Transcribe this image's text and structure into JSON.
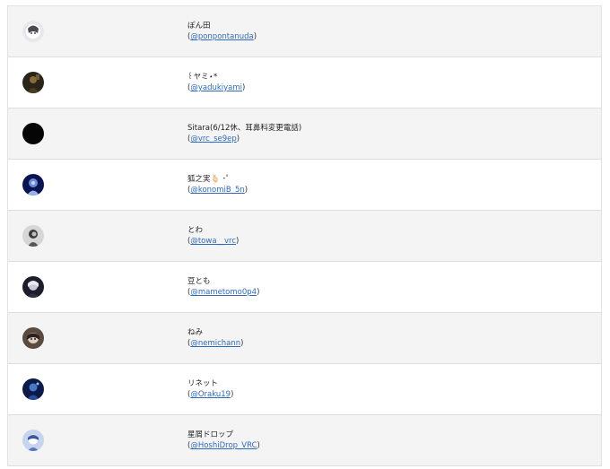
{
  "users": [
    {
      "display_name": "ぽん田",
      "handle": "@ponpontanuda",
      "avatar_icon": "avatar-cartoon-icon",
      "colors": [
        "#e8e8ec",
        "#4a4a55"
      ]
    },
    {
      "display_name": "꒰ヤミ⋆*",
      "handle": "@yadukiyami",
      "avatar_icon": "avatar-dark-figure-icon",
      "colors": [
        "#2b2418",
        "#8a6a3a"
      ]
    },
    {
      "display_name": "Sitara(6/12休、耳鼻科変更電話)",
      "handle": "@vrc_se9ep",
      "avatar_icon": "avatar-black-icon",
      "colors": [
        "#050505",
        "#050505"
      ]
    },
    {
      "display_name": "狐之実🫰🏻 ･ﾟ",
      "handle": "@konomiB_5n",
      "avatar_icon": "avatar-blue-figure-icon",
      "colors": [
        "#0a1450",
        "#6f8ad8"
      ]
    },
    {
      "display_name": "とわ",
      "handle": "@towa__vrc",
      "avatar_icon": "avatar-gray-figure-icon",
      "colors": [
        "#d6d6d6",
        "#3a3a3a"
      ]
    },
    {
      "display_name": "豆とも",
      "handle": "@mametomo0p4",
      "avatar_icon": "avatar-dark-portrait-icon",
      "colors": [
        "#1c1c2a",
        "#c8c8d8"
      ]
    },
    {
      "display_name": "ねみ",
      "handle": "@nemichann",
      "avatar_icon": "avatar-brown-portrait-icon",
      "colors": [
        "#5a4a40",
        "#e0d0c0"
      ]
    },
    {
      "display_name": "リネット",
      "handle": "@Oraku19",
      "avatar_icon": "avatar-navy-figure-icon",
      "colors": [
        "#0c1a4a",
        "#4a78c8"
      ]
    },
    {
      "display_name": "星屑ドロップ",
      "handle": "@HoshiDrop_VRC",
      "avatar_icon": "avatar-light-blue-icon",
      "colors": [
        "#c6d4ee",
        "#3c56a0"
      ]
    }
  ]
}
